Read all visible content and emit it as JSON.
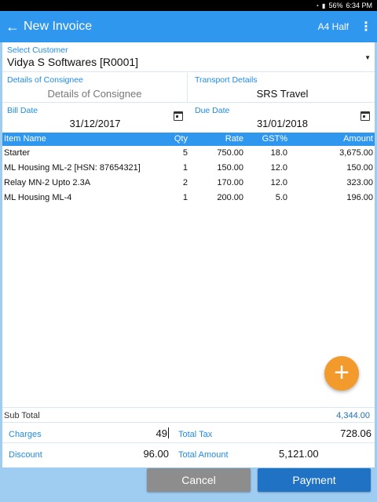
{
  "status": {
    "battery": "56%",
    "time": "6:34 PM"
  },
  "appbar": {
    "title": "New Invoice",
    "page_size": "A4 Half"
  },
  "customer": {
    "label": "Select Customer",
    "value": "Vidya S Softwares [R0001]"
  },
  "consignee": {
    "label": "Details of Consignee",
    "placeholder": "Details of Consignee"
  },
  "transport": {
    "label": "Transport Details",
    "value": "SRS Travel"
  },
  "bill_date": {
    "label": "Bill Date",
    "value": "31/12/2017"
  },
  "due_date": {
    "label": "Due Date",
    "value": "31/01/2018"
  },
  "table": {
    "headers": {
      "name": "Item Name",
      "qty": "Qty",
      "rate": "Rate",
      "gst": "GST%",
      "amount": "Amount"
    },
    "rows": [
      {
        "name": "Starter",
        "qty": "5",
        "rate": "750.00",
        "gst": "18.0",
        "amount": "3,675.00"
      },
      {
        "name": "ML Housing ML-2 [HSN: 87654321]",
        "qty": "1",
        "rate": "150.00",
        "gst": "12.0",
        "amount": "150.00"
      },
      {
        "name": "Relay MN-2 Upto 2.3A",
        "qty": "2",
        "rate": "170.00",
        "gst": "12.0",
        "amount": "323.00"
      },
      {
        "name": "ML Housing ML-4",
        "qty": "1",
        "rate": "200.00",
        "gst": "5.0",
        "amount": "196.00"
      }
    ]
  },
  "totals": {
    "sub_total_label": "Sub Total",
    "sub_total_value": "4,344.00",
    "charges_label": "Charges",
    "charges_value": "49",
    "total_tax_label": "Total Tax",
    "total_tax_value": "728.06",
    "discount_label": "Discount",
    "discount_value": "96.00",
    "total_amount_label": "Total Amount",
    "total_amount_value": "5,121.00"
  },
  "buttons": {
    "cancel": "Cancel",
    "payment": "Payment"
  },
  "colors": {
    "primary": "#2f97ee",
    "accent": "#f39a2c",
    "payment": "#1f72c4",
    "cancel": "#8d8d8d"
  }
}
